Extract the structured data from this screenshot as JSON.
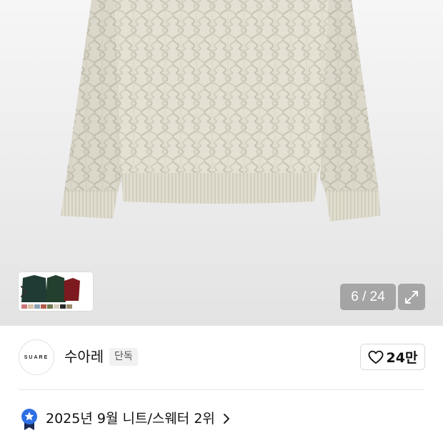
{
  "gallery": {
    "counter_current": "6",
    "counter_separator": "/",
    "counter_total": "24",
    "thumbnail_colors": [
      "#1f3b34",
      "#23402f",
      "#7d1a1f",
      "#c97a7a",
      "#d9c1a6",
      "#8fa2b6",
      "#b05b4b",
      "#6f7b4f"
    ]
  },
  "brand": {
    "logo_text": "SUARE",
    "name": "수아레",
    "badge": "단독"
  },
  "like": {
    "count": "24만"
  },
  "ranking": {
    "text": "2025년 9월 니트/스웨터 2위"
  },
  "colors": {
    "sweater": "#e4e1d4",
    "medal_blue": "#2f6fe4",
    "medal_dark": "#1a2a55"
  }
}
